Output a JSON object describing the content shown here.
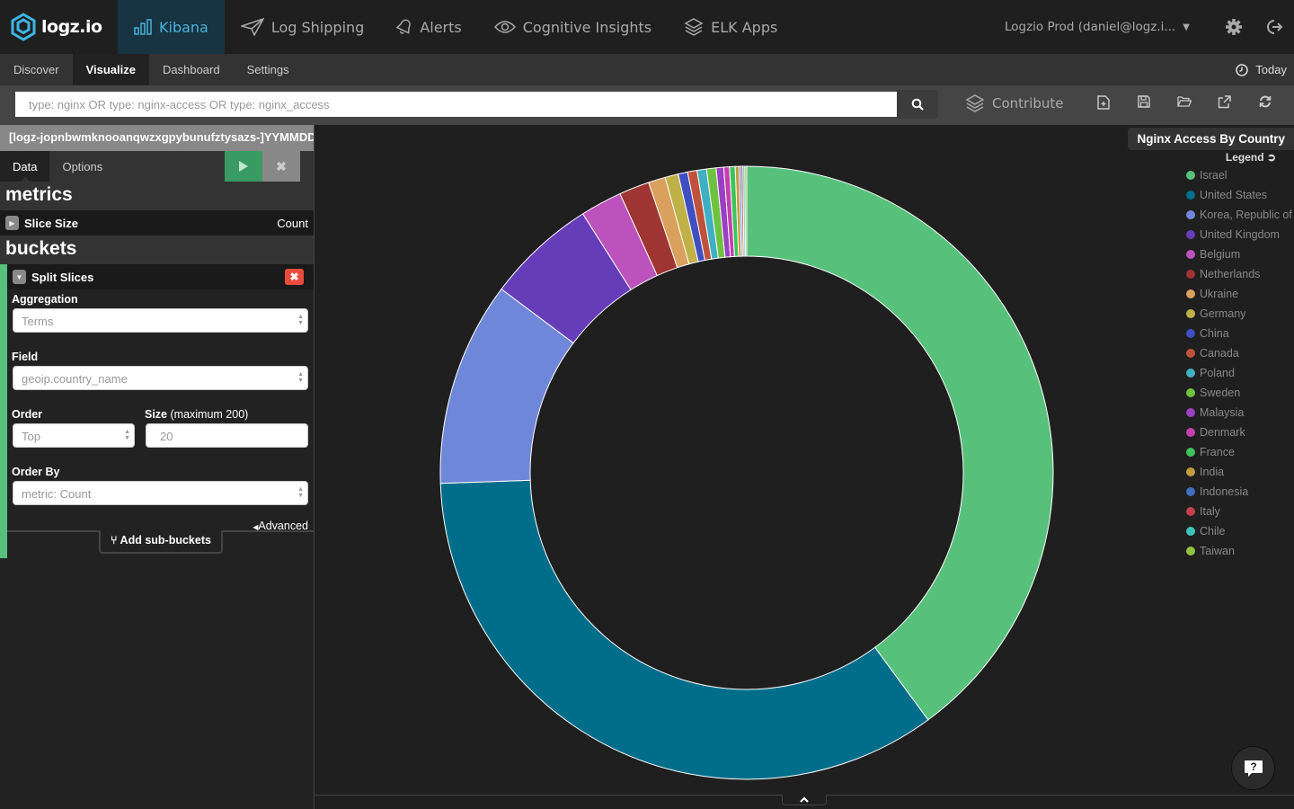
{
  "topbar": {
    "logo_text": "logz.io",
    "nav": [
      {
        "label": "Kibana",
        "icon": "bar-chart-icon",
        "active": true
      },
      {
        "label": "Log Shipping",
        "icon": "paper-plane-icon"
      },
      {
        "label": "Alerts",
        "icon": "bell-icon"
      },
      {
        "label": "Cognitive Insights",
        "icon": "eye-icon"
      },
      {
        "label": "ELK Apps",
        "icon": "layers-icon"
      }
    ],
    "account": "Logzio Prod (daniel@logz.i...",
    "settings_icon": "gear-icon",
    "logout_icon": "logout-icon"
  },
  "subnav": {
    "items": [
      {
        "label": "Discover"
      },
      {
        "label": "Visualize",
        "active": true
      },
      {
        "label": "Dashboard"
      },
      {
        "label": "Settings"
      }
    ],
    "time_label": "Today"
  },
  "query": {
    "placeholder": "type: nginx OR type: nginx-access OR type: nginx_access",
    "value": "",
    "contribute_label": "Contribute"
  },
  "sidebar": {
    "index_pattern": "[logz-jopnbwmknooanqwzxgpybunufztysazs-]YYMMDD",
    "tabs": [
      "Data",
      "Options"
    ],
    "metrics_heading": "metrics",
    "metric": {
      "title": "Slice Size",
      "value": "Count"
    },
    "buckets_heading": "buckets",
    "bucket": {
      "title": "Split Slices",
      "aggregation_label": "Aggregation",
      "aggregation_value": "Terms",
      "field_label": "Field",
      "field_value": "geoip.country_name",
      "order_label": "Order",
      "order_value": "Top",
      "size_label": "Size",
      "size_hint": "(maximum 200)",
      "size_value": "20",
      "order_by_label": "Order By",
      "order_by_value": "metric: Count",
      "advanced_label": "Advanced",
      "add_sub_buckets_label": "Add sub-buckets"
    }
  },
  "visualization": {
    "title": "Nginx Access By Country",
    "legend_label": "Legend"
  },
  "chart_data": {
    "type": "pie",
    "donut": true,
    "title": "Nginx Access By Country",
    "legend_position": "right",
    "unit": "approx. share of Count (%)",
    "categories": [
      "Israel",
      "United States",
      "Korea, Republic of",
      "United Kingdom",
      "Belgium",
      "Netherlands",
      "Ukraine",
      "Germany",
      "China",
      "Canada",
      "Poland",
      "Sweden",
      "Malaysia",
      "Denmark",
      "France",
      "India",
      "Indonesia",
      "Italy",
      "Chile",
      "Taiwan"
    ],
    "values": [
      40.0,
      34.6,
      10.8,
      5.8,
      2.2,
      1.6,
      0.9,
      0.7,
      0.5,
      0.5,
      0.5,
      0.5,
      0.4,
      0.3,
      0.3,
      0.2,
      0.1,
      0.1,
      0.1,
      0.1
    ],
    "colors": [
      "#57c17b",
      "#006e8a",
      "#6f87d8",
      "#663db8",
      "#bc52bc",
      "#9e3533",
      "#daa05d",
      "#bfb148",
      "#3f4ec3",
      "#c0513d",
      "#3fb0c3",
      "#6fc23f",
      "#9b3fc3",
      "#c33fb0",
      "#3fc35a",
      "#c39b3f",
      "#3f6ec3",
      "#c33f4e",
      "#3fc3b9",
      "#8fc33f"
    ]
  },
  "help_icon": "help-chat-icon"
}
